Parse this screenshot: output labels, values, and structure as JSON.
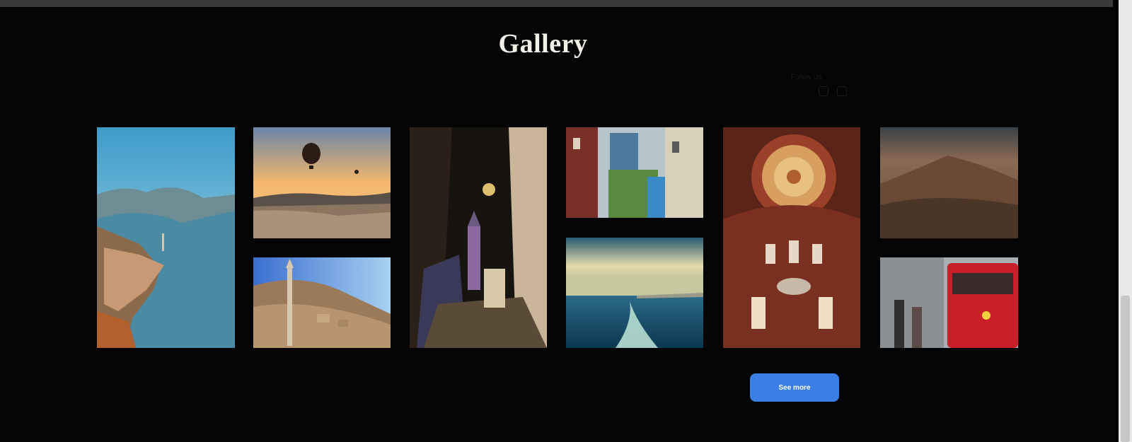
{
  "section": {
    "title": "Gallery"
  },
  "header_faint": {
    "social_label": "Follow Us"
  },
  "actions": {
    "see_more_label": "See more"
  },
  "images": [
    "coastal-bay-town",
    "hot-air-balloons-sunset",
    "night-alley-galata-tower",
    "colorful-historic-houses",
    "mosque-dome-interior",
    "misty-mountain-range",
    "hillside-minaret-village",
    "sea-ferry-wake",
    "red-tram-snow-street"
  ],
  "colors": {
    "background": "#040404",
    "accent": "#3b7ee6",
    "title": "#f1efe8"
  }
}
